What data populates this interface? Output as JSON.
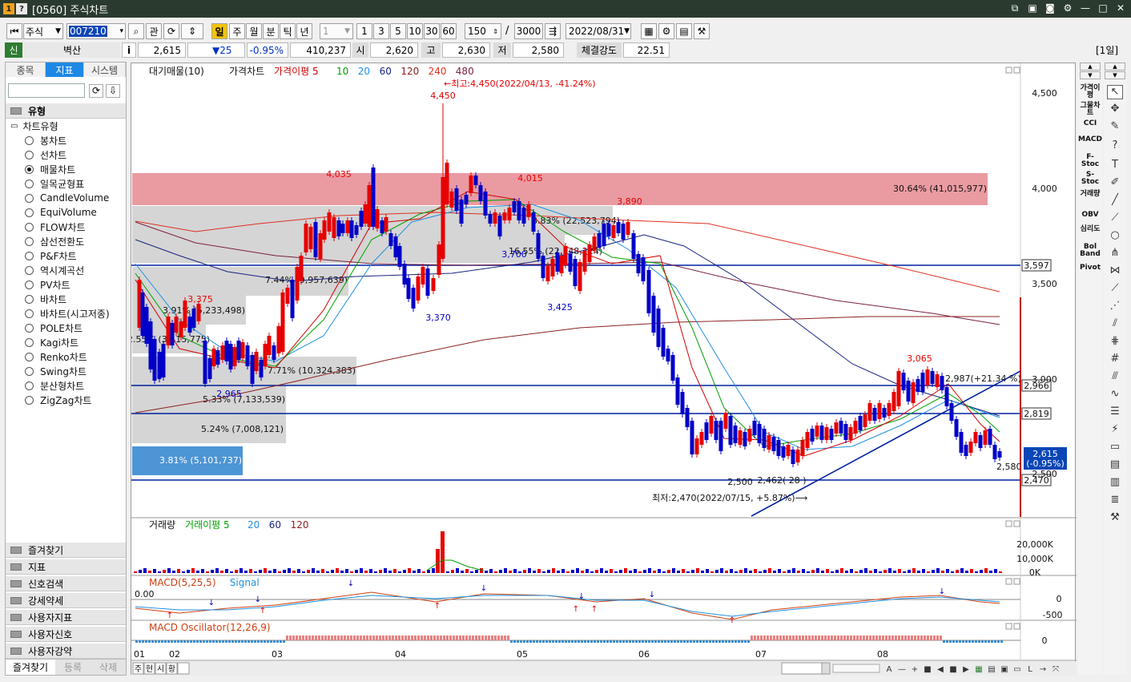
{
  "window": {
    "icon_a": "1",
    "icon_b": "?",
    "title": "[0560] 주식차트"
  },
  "toolbar": {
    "market": "주식",
    "code": "007210",
    "btn_gwan": "관",
    "periods": [
      "일",
      "주",
      "월",
      "분",
      "틱",
      "년"
    ],
    "tick_value": "1",
    "intervals": [
      "1",
      "3",
      "5",
      "10",
      "30",
      "60"
    ],
    "count": "150",
    "slash": "/",
    "total": "3000",
    "date": "2022/08/31"
  },
  "quote": {
    "flag": "신",
    "name": "벽산",
    "info": "i",
    "price": "2,615",
    "change": "▼25",
    "change_pct": "-0.95%",
    "volume": "410,237",
    "open_label": "시",
    "open": "2,620",
    "high_label": "고",
    "high": "2,630",
    "low_label": "저",
    "low": "2,580",
    "strength_label": "체결강도",
    "strength": "22.51",
    "period_tag": "[1일]"
  },
  "sidebar": {
    "tabs": [
      "종목",
      "지표",
      "시스템"
    ],
    "section": "유형",
    "group": "차트유형",
    "items": [
      "봉차트",
      "선차트",
      "매물차트",
      "일목균형표",
      "CandleVolume",
      "EquiVolume",
      "FLOW차트",
      "삼선전환도",
      "P&F차트",
      "역시계곡선",
      "PV차트",
      "바차트",
      "바차트(시고저종)",
      "POLE차트",
      "Kagi차트",
      "Renko차트",
      "Swing차트",
      "분산형차트",
      "ZigZag차트"
    ],
    "selected_index": 2,
    "folders": [
      "즐겨찾기",
      "지표",
      "신호검색",
      "강세약세",
      "사용자지표",
      "사용자신호",
      "사용자강약"
    ],
    "bottom_tabs": [
      "즐겨찾기",
      "등록",
      "삭제"
    ]
  },
  "chart": {
    "legend_main": [
      {
        "text": "대기매물(10)",
        "color": "#111111"
      },
      {
        "text": "가격차트",
        "color": "#111111"
      },
      {
        "text": "가격이평 5",
        "color": "#d00000"
      },
      {
        "text": "10",
        "color": "#00a000"
      },
      {
        "text": "20",
        "color": "#2090e0"
      },
      {
        "text": "60",
        "color": "#1a237e"
      },
      {
        "text": "120",
        "color": "#8b2020"
      },
      {
        "text": "240",
        "color": "#e03020"
      },
      {
        "text": "480",
        "color": "#7a2040"
      }
    ],
    "price_axis": [
      "4,500",
      "4,000",
      "3,500",
      "3,000",
      "2,500"
    ],
    "high_note": "←최고:4,450(2022/04/13, -41.24%)",
    "low_note": "최저:2,470(2022/07/15, +5.87%)⟶",
    "price_labels": [
      "4,450",
      "4,035",
      "4,015",
      "3,890",
      "3,375",
      "3,370",
      "3,700",
      "3,425",
      "2,965",
      "3,065",
      "2,987(+21.34 %)",
      "2,500",
      "2,462( 28 )",
      "2,580"
    ],
    "volume_profile": [
      "30.64% (41,015,977)",
      "8.83% (22,523,794)",
      "16.55% (22,148,224)",
      "7.44% (9,957,639)",
      "3.91% (5,233,498)",
      "2.55% (3,415,775)",
      "7.71% (10,324,383)",
      "5.33% (7,133,539)",
      "5.24% (7,008,121)",
      "3.81% (5,101,737)"
    ],
    "hlines": [
      "3,597",
      "2,966",
      "2,819",
      "2,470"
    ],
    "current_price": "2,615",
    "current_change": "(-0.95%)",
    "volume_legend": [
      {
        "text": "거래량",
        "color": "#111111"
      },
      {
        "text": "거래이평 5",
        "color": "#00a000"
      },
      {
        "text": "20",
        "color": "#2090e0"
      },
      {
        "text": "60",
        "color": "#1a237e"
      },
      {
        "text": "120",
        "color": "#8b2020"
      }
    ],
    "volume_axis": [
      "20,000K",
      "10,000K",
      "0K"
    ],
    "macd_legend": [
      {
        "text": "MACD(5,25,5)",
        "color": "#d04010"
      },
      {
        "text": "Signal",
        "color": "#2090e0"
      }
    ],
    "macd_value": "0.00",
    "macd_axis": [
      "0",
      "-500"
    ],
    "osc_legend": "MACD Oscillator(12,26,9)",
    "osc_axis": [
      "0"
    ],
    "months": [
      "01",
      "02",
      "03",
      "04",
      "05",
      "06",
      "07",
      "08"
    ],
    "bottom_buttons": [
      "주",
      "현",
      "시",
      "황"
    ]
  },
  "right_indicators": [
    "가격이평",
    "그물차트",
    "CCI",
    "MACD",
    "F-Stoc",
    "S-Stoc",
    "거래량",
    "OBV",
    "심리도",
    "Bol Band",
    "Pivot"
  ],
  "colors": {
    "up": "#e60000",
    "down": "#0000c8",
    "band": "#e89098",
    "gray_band": "#d0d0d0",
    "blue_box": "#3a8ad0",
    "hline": "#0022a0"
  }
}
